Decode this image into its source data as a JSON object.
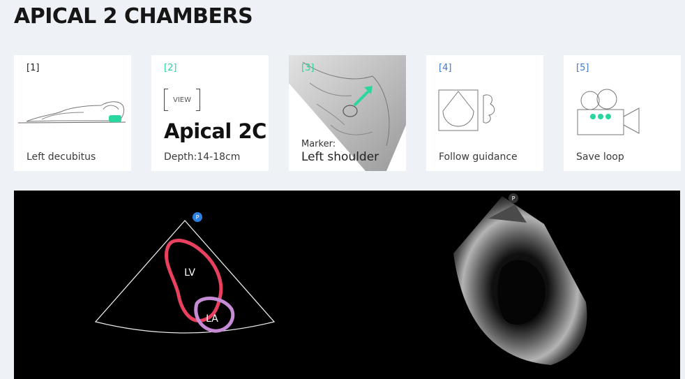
{
  "page": {
    "title": "APICAL 2 CHAMBERS"
  },
  "steps": [
    {
      "number": "[1]",
      "label": "Left decubitus"
    },
    {
      "number": "[2]",
      "view_tag": "VIEW",
      "view_name": "Apical 2C",
      "label": "Depth:14-18cm"
    },
    {
      "number": "[3]",
      "marker_label": "Marker:",
      "marker_value": "Left shoulder"
    },
    {
      "number": "[4]",
      "label": "Follow guidance"
    },
    {
      "number": "[5]",
      "label": "Save loop"
    }
  ],
  "diagram": {
    "probe_marker": "P",
    "chambers": [
      "LV",
      "LA"
    ],
    "colors": {
      "lv": "#e8415f",
      "la": "#c78bd6",
      "marker": "#2f7fe0"
    }
  },
  "ultrasound": {
    "probe_marker": "P"
  },
  "colors": {
    "accent_green": "#2ad6a0",
    "accent_blue": "#3b78d6"
  }
}
